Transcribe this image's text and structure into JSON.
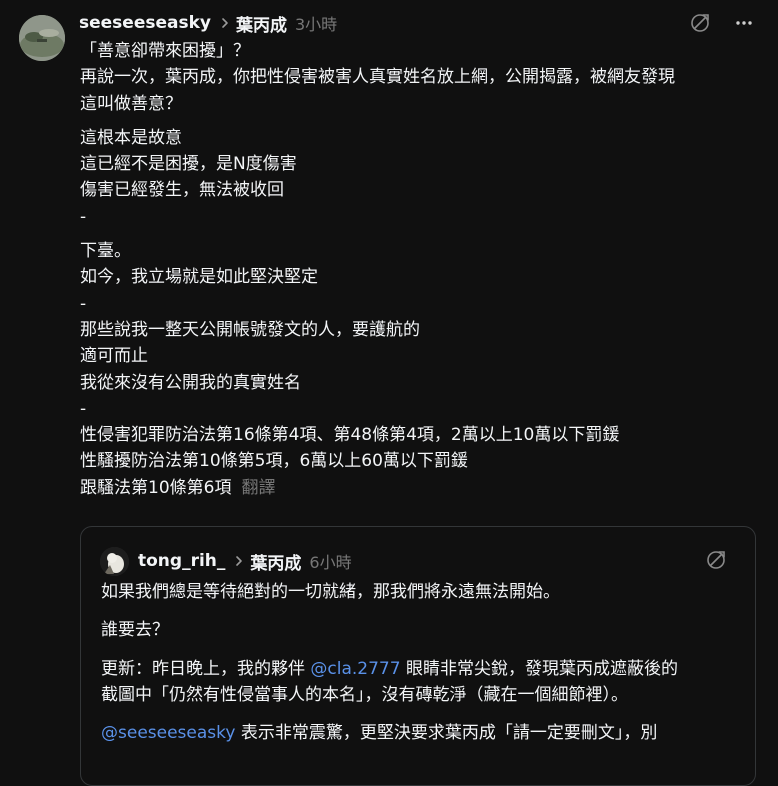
{
  "post": {
    "username": "seeseeseasky",
    "reply_to": "葉丙成",
    "time": "3小時",
    "paragraphs": [
      [
        "「善意卻帶來困擾」？",
        "再說一次，葉丙成，你把性侵害被害人真實姓名放上網，公開揭露，被網友發現",
        "這叫做善意？"
      ],
      [
        "這根本是故意",
        "這已經不是困擾，是N度傷害",
        "傷害已經發生，無法被收回",
        "-"
      ],
      [
        "下臺。",
        "如今，我立場就是如此堅決堅定",
        "-",
        "那些說我一整天公開帳號發文的人，要護航的",
        "適可而止",
        "我從來沒有公開我的真實姓名",
        "-",
        "性侵害犯罪防治法第16條第4項、第48條第4項，2萬以上10萬以下罰鍰",
        "性騷擾防治法第10條第5項，6萬以上60萬以下罰鍰"
      ],
      []
    ],
    "last_line": "跟騷法第10條第6項",
    "translate_label": "翻譯"
  },
  "quote": {
    "username": "tong_rih_",
    "reply_to": "葉丙成",
    "time": "6小時",
    "p1": "如果我們總是等待絕對的一切就緒，那我們將永遠無法開始。",
    "p2": "誰要去？",
    "p3_pre": "更新：昨日晚上，我的夥伴 ",
    "p3_mention": "@cla.2777",
    "p3_post": " 眼睛非常尖銳，發現葉丙成遮蔽後的",
    "p3_line2": "截圖中「仍然有性侵當事人的本名」，沒有磚乾淨（藏在一個細節裡）。",
    "p4_mention": "@seeseeseasky",
    "p4_post": " 表示非常震驚，更堅決要求葉丙成「請一定要刪文」，別"
  },
  "icons": {
    "more": "more-icon",
    "ai_sparkle": "no-reply-icon"
  }
}
